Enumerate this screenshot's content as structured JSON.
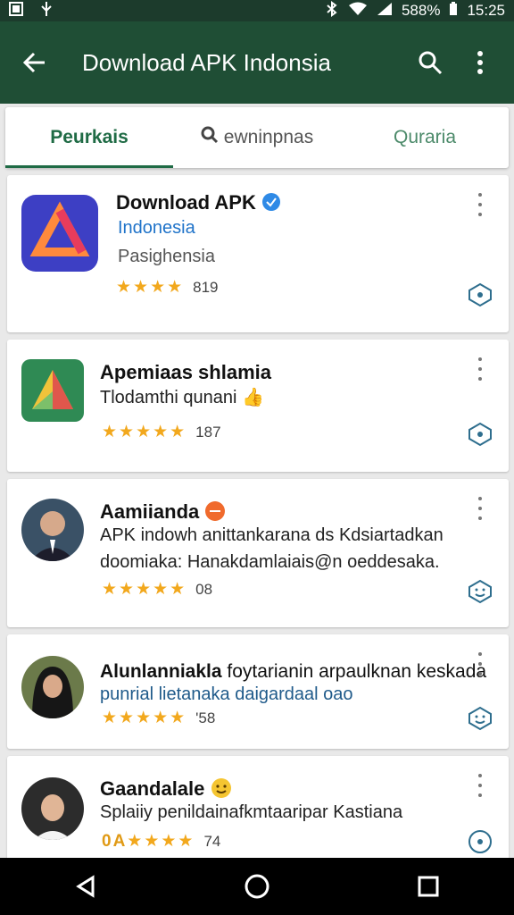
{
  "status": {
    "left_icons": [
      "image-icon",
      "usb-icon"
    ],
    "battery": "588%",
    "time": "15:25"
  },
  "appbar": {
    "title": "Download APK Indonsia",
    "back_icon": "back-arrow-icon",
    "search_icon": "search-icon",
    "menu_icon": "overflow-menu-icon"
  },
  "tabs": [
    {
      "label": "Peurkais",
      "active": true
    },
    {
      "label": "ewninpnas",
      "icon": "search-icon"
    },
    {
      "label": "Quraria"
    }
  ],
  "items": [
    {
      "title": "Download APK",
      "verified": true,
      "subtitle": "Indonesia",
      "meta": "Pasighensia",
      "stars": "★★★★",
      "count": "819"
    },
    {
      "title": "Apemiaas shlamia",
      "meta": "Tlodamthi qunani",
      "stars": "★★★★★",
      "count": "187"
    },
    {
      "title": "Aamiianda",
      "line1": "APK indowh anittankarana ds Kdsiartadkan",
      "line2": "doomiaka: Hanakdamlaiais@n oeddesaka.",
      "stars": "★★★★★",
      "count": "08"
    },
    {
      "title": "Alunlanniakla",
      "title_rest": "foytarianin arpaulknan keskada",
      "line2": "punrial lietanaka daigardaal oao",
      "stars": "★★★★★",
      "count": "'58"
    },
    {
      "title": "Gaandalale",
      "meta": "Splaiiy penildainafkmtaaripar Kastiana",
      "stars": "★★★★",
      "stars_prefix": "0A",
      "count": "74"
    }
  ],
  "colors": {
    "appbar": "#1f4e35",
    "accent": "#1f6b45",
    "star": "#f2a81d",
    "link": "#1f73c9"
  },
  "nav": [
    "back-icon",
    "home-icon",
    "recents-icon"
  ]
}
